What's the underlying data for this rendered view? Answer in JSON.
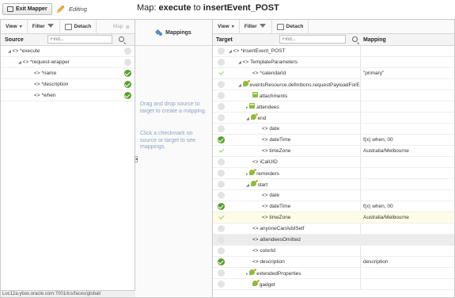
{
  "topbar": {
    "exit_label": "Exit Mapper",
    "editing_label": "Editing",
    "title_prefix": "Map: ",
    "title_source": "execute",
    "title_to": " to ",
    "title_target": "insertEvent_POST"
  },
  "left_toolbar": {
    "view": "View",
    "filter": "Filter",
    "detach": "Detach",
    "map": "Map"
  },
  "source": {
    "header": "Source",
    "find_placeholder": "Find...",
    "rows": [
      {
        "label": "*execute",
        "check": false
      },
      {
        "label": "*request-wrapper",
        "check": false
      },
      {
        "label": "*name",
        "check": true
      },
      {
        "label": "*description",
        "check": true
      },
      {
        "label": "*when",
        "check": true
      }
    ]
  },
  "mappings": {
    "header": "Mappings",
    "text1": "Drag and drop source to target to create a mapping.",
    "text2": "Click a checkmark on source or target to see mappings."
  },
  "right_toolbar": {
    "view": "View",
    "filter": "Filter",
    "detach": "Detach"
  },
  "target": {
    "header": "Target",
    "find_placeholder": "Find...",
    "mapping_header": "Mapping",
    "rows": [
      {
        "label": "*insertEvent_POST",
        "mapping": ""
      },
      {
        "label": "TemplateParameters",
        "mapping": ""
      },
      {
        "label": "*calendarId",
        "mapping": "\"primary\""
      },
      {
        "label": "eventsResource.definitions.requestPayloadForE",
        "mapping": ""
      },
      {
        "label": "attachments",
        "mapping": ""
      },
      {
        "label": "attendees",
        "mapping": ""
      },
      {
        "label": "end",
        "mapping": ""
      },
      {
        "label": "date",
        "mapping": ""
      },
      {
        "label": "dateTime",
        "mapping": "f(x) when, 00"
      },
      {
        "label": "timeZone",
        "mapping": "Australia/Melbourne"
      },
      {
        "label": "iCalUID",
        "mapping": ""
      },
      {
        "label": "reminders",
        "mapping": ""
      },
      {
        "label": "start",
        "mapping": ""
      },
      {
        "label": "date",
        "mapping": ""
      },
      {
        "label": "dateTime",
        "mapping": "f(x) when, 00"
      },
      {
        "label": "timeZone",
        "mapping": "Australia/Melbourne"
      },
      {
        "label": "anyoneCanAddSelf",
        "mapping": ""
      },
      {
        "label": "attendeesOmitted",
        "mapping": ""
      },
      {
        "label": "colorId",
        "mapping": ""
      },
      {
        "label": "description",
        "mapping": "description"
      },
      {
        "label": "extendedProperties",
        "mapping": ""
      },
      {
        "label": "gadget",
        "mapping": ""
      }
    ]
  },
  "status_bar": "Loc12a.ybox.oracle.com:7001/ics/faces/global/",
  "colors": {
    "check_green": "#5aa02c",
    "link_blue": "#4b8bc8",
    "highlight_yellow": "#fefce6"
  }
}
